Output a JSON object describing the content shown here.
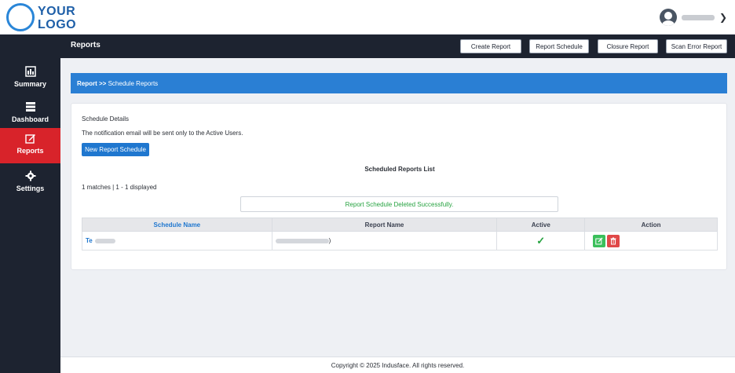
{
  "logo": {
    "line1": "YOUR",
    "line2": "LOGO"
  },
  "user": {
    "menu_icon": "chevron-down-icon"
  },
  "sidebar": {
    "items": [
      {
        "label": "Summary",
        "icon": "summary-icon"
      },
      {
        "label": "Dashboard",
        "icon": "dashboard-icon"
      },
      {
        "label": "Reports",
        "icon": "reports-icon",
        "active": true
      },
      {
        "label": "Settings",
        "icon": "settings-icon"
      }
    ]
  },
  "pagebar": {
    "title": "Reports",
    "buttons": [
      "Create Report",
      "Report Schedule",
      "Closure Report",
      "Scan Error Report"
    ]
  },
  "breadcrumb": {
    "root": "Report >>",
    "current": "Schedule Reports"
  },
  "card": {
    "section_title": "Schedule Details",
    "note": "The notification email will be sent only to the Active Users.",
    "new_button": "New Report Schedule",
    "list_title": "Scheduled Reports List",
    "matches": "1 matches | 1 - 1 displayed",
    "success_message": "Report Schedule Deleted Successfully."
  },
  "table": {
    "headers": [
      "Schedule Name",
      "Report Name",
      "Active",
      "Action"
    ],
    "rows": [
      {
        "schedule_name": "Te",
        "report_name": ")",
        "active": "✓"
      }
    ]
  },
  "footer": {
    "text": "Copyright © 2025 Indusface. All rights reserved."
  },
  "colors": {
    "accent": "#1f77cf",
    "active_nav": "#d8232a",
    "success": "#27a341",
    "dark": "#1d2330"
  }
}
